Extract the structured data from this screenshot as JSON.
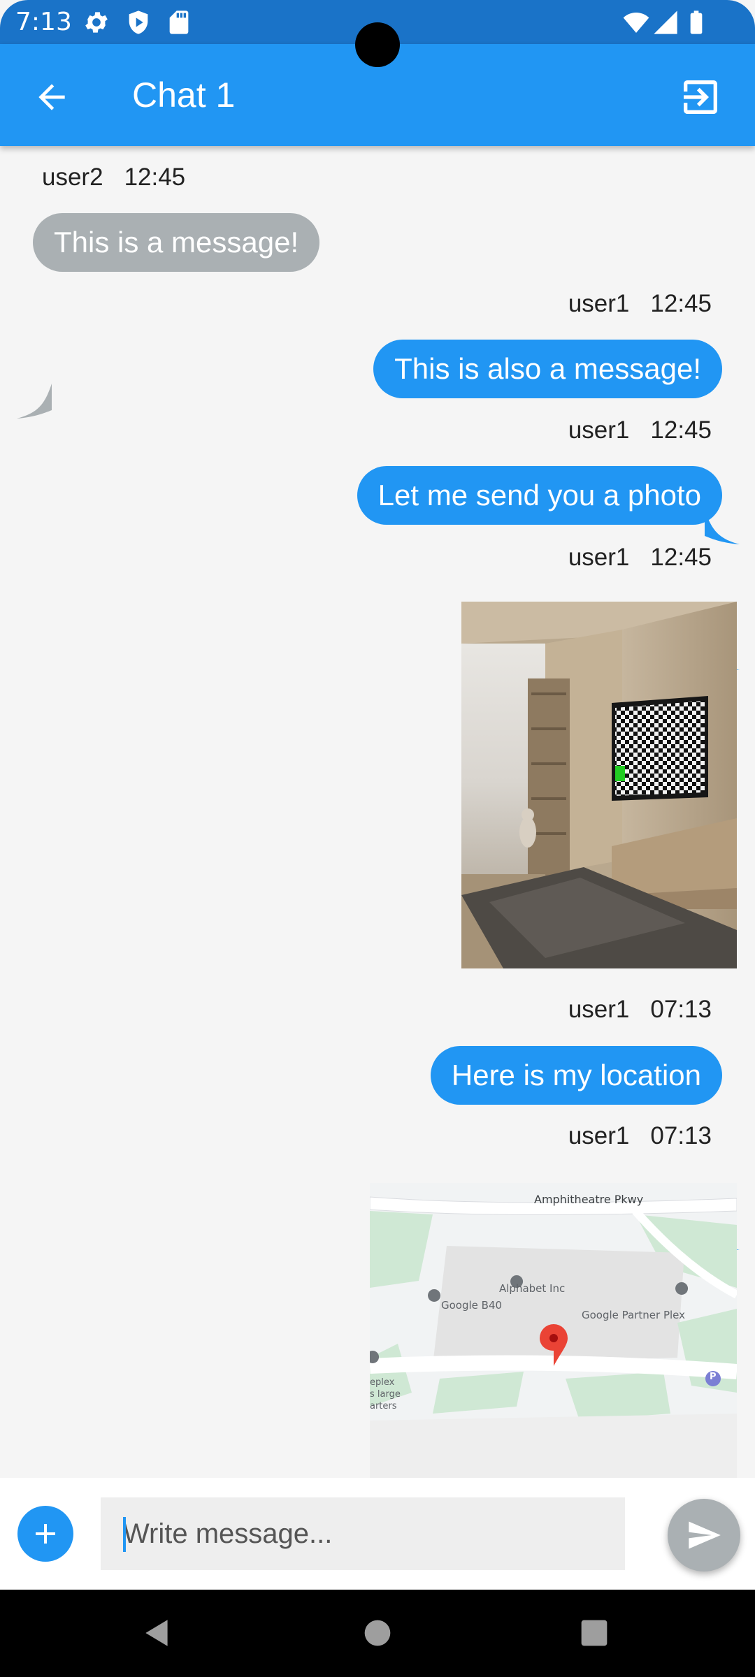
{
  "status_bar": {
    "time": "7:13",
    "icons": [
      "gear-icon",
      "shield-icon",
      "sd-card-icon",
      "wifi-icon",
      "signal-icon",
      "battery-icon"
    ]
  },
  "app_bar": {
    "title": "Chat 1",
    "back_icon": "arrow-left-icon",
    "exit_icon": "exit-icon",
    "color": "#2196f3"
  },
  "messages": [
    {
      "user": "user2",
      "time": "12:45",
      "text": "This is a message!",
      "direction": "incoming"
    },
    {
      "user": "user1",
      "time": "12:45",
      "text": "This is also a message!",
      "direction": "outgoing"
    },
    {
      "user": "user1",
      "time": "12:45",
      "text": "Let me send you a photo",
      "direction": "outgoing"
    },
    {
      "user": "user1",
      "time": "12:45",
      "type": "photo",
      "direction": "outgoing"
    },
    {
      "user": "user1",
      "time": "07:13",
      "text": "Here is my location",
      "direction": "outgoing"
    },
    {
      "user": "user1",
      "time": "07:13",
      "type": "map",
      "direction": "outgoing"
    }
  ],
  "map": {
    "labels": {
      "road": "Amphitheatre Pkwy",
      "poi1": "Alphabet Inc",
      "poi2": "Google B40",
      "poi3": "Google Partner Plex",
      "edge1": "eplex",
      "edge2": "s large",
      "edge3": "arters",
      "parking": "P"
    }
  },
  "composer": {
    "placeholder": "Write message...",
    "add_icon": "plus-icon",
    "send_icon": "send-icon"
  },
  "colors": {
    "outgoing_bubble": "#2196f3",
    "incoming_bubble": "#aab0b3",
    "background": "#f5f5f5"
  },
  "nav_bar": {
    "icons": [
      "back-triangle-icon",
      "home-circle-icon",
      "recents-square-icon"
    ]
  }
}
